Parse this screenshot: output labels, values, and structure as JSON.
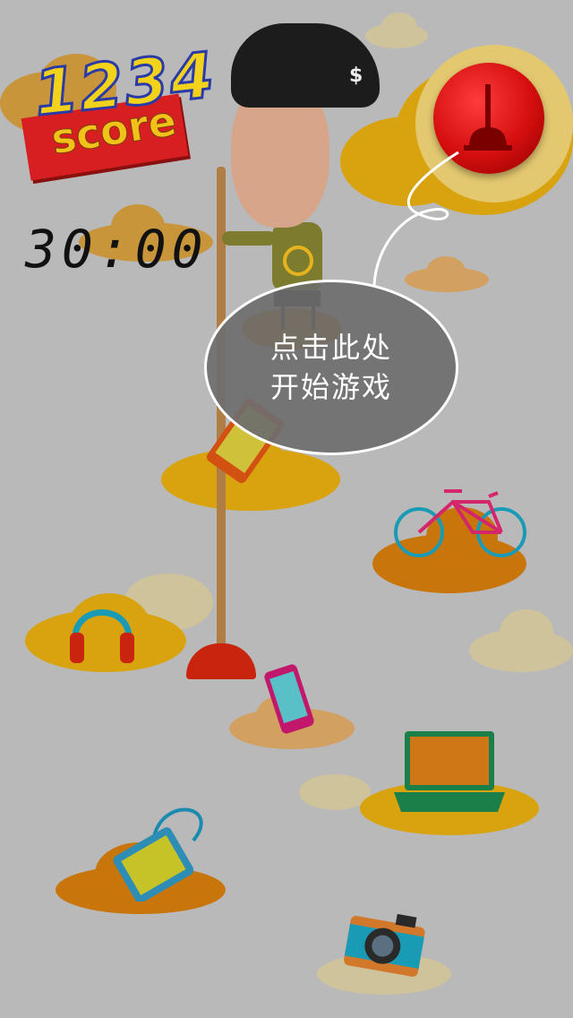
{
  "score": {
    "value": "1234",
    "label": "score"
  },
  "timer": {
    "value": "30:00"
  },
  "prompt": {
    "line1": "点击此处",
    "line2": "开始游戏"
  },
  "icons": {
    "start_button": "plunger-icon",
    "items": [
      "tablet-icon",
      "bicycle-icon",
      "headphones-icon",
      "phone-icon",
      "laptop-icon",
      "handbag-icon",
      "camera-icon"
    ]
  },
  "colors": {
    "background": "#b9b9b9",
    "cloud_orange": "#c8750b",
    "cloud_gold": "#d8a30e",
    "cloud_pale": "#cfc39c",
    "score_yellow": "#f2d21a",
    "score_red": "#d71f22",
    "button_red": "#d40e0e"
  }
}
